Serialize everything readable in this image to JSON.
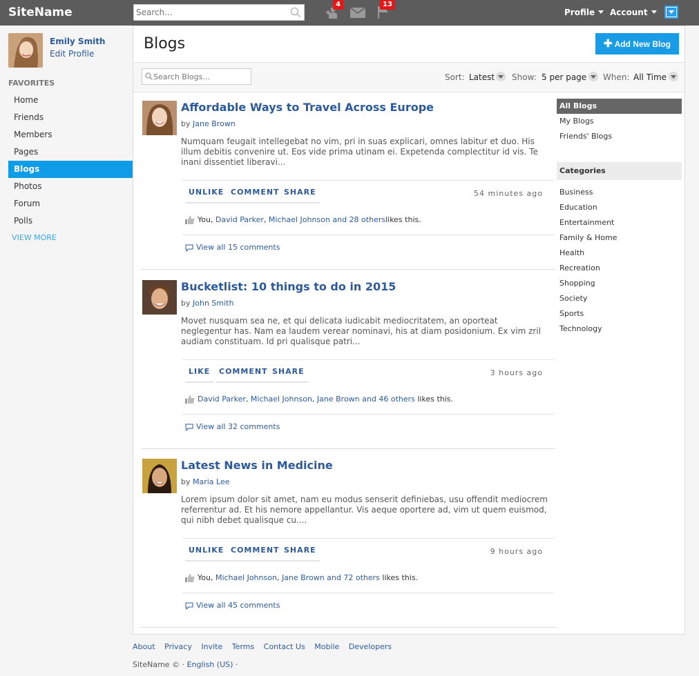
{
  "topbar": {
    "site_name": "SiteName",
    "search_placeholder": "Search...",
    "friend_requests_count": "4",
    "notifications_count": "13",
    "profile_menu": "Profile",
    "account_menu": "Account"
  },
  "sidebar": {
    "user_name": "Emily Smith",
    "edit_profile": "Edit Profile",
    "favorites_heading": "FAVORITES",
    "items": [
      {
        "label": "Home"
      },
      {
        "label": "Friends"
      },
      {
        "label": "Members"
      },
      {
        "label": "Pages"
      },
      {
        "label": "Blogs"
      },
      {
        "label": "Photos"
      },
      {
        "label": "Forum"
      },
      {
        "label": "Polls"
      }
    ],
    "active_item": "Blogs",
    "view_more": "VIEW MORE"
  },
  "main": {
    "title": "Blogs",
    "add_button": "Add New Blog",
    "search_placeholder": "Search Blogs...",
    "sort_label": "Sort:",
    "sort_value": "Latest",
    "show_label": "Show:",
    "show_value": "5 per page",
    "when_label": "When:",
    "when_value": "All Time"
  },
  "posts": [
    {
      "title": "Affordable Ways to Travel Across Europe",
      "by": "by",
      "author": "Jane Brown",
      "excerpt": "Numquam feugait intellegebat no vim, pri in suas explicari, omnes labitur et duo. His illum debitis convenire ut. Eos vide prima utinam ei. Expetenda complectitur id vis. Te inani dissentiet liberavi...",
      "like_action": "UNLIKE",
      "comment_action": "COMMENT",
      "share_action": "SHARE",
      "time": "54 minutes ago",
      "likes_prefix": "You, ",
      "likes_names": "David Parker",
      "likes_sep": ", ",
      "likes_more": "Michael Johnson and 28 others",
      "likes_suffix": "likes this.",
      "view_comments": "View all 15 comments"
    },
    {
      "title": "Bucketlist: 10 things to do in 2015",
      "by": "by",
      "author": "John Smith",
      "excerpt": "Movet nusquam sea ne, et qui delicata iudicabit mediocritatem, an oporteat neglegentur has. Nam ea laudem verear nominavi, his at diam posidonium. Ex vim zril audiam constituam. Id pri qualisque patri...",
      "like_action": "LIKE",
      "comment_action": "COMMENT",
      "share_action": "SHARE",
      "time": "3 hours ago",
      "likes_prefix": "",
      "likes_names": "David Parker, Michael Johnson",
      "likes_sep": ", ",
      "likes_more": "Jane Brown and 46 others",
      "likes_suffix": " likes this.",
      "view_comments": "View all 32 comments"
    },
    {
      "title": "Latest News in Medicine",
      "by": "by",
      "author": "Maria Lee",
      "excerpt": "Lorem ipsum dolor sit amet, nam eu modus senserit definiebas, usu offendit mediocrem referrentur ad. Et his nemore appellantur. Vis aeque oportere ad, vim ut quem euismod, qui nibh debet qualisque cu....",
      "like_action": "UNLIKE",
      "comment_action": "COMMENT",
      "share_action": "SHARE",
      "time": "9 hours ago",
      "likes_prefix": "You, ",
      "likes_names": "Michael Johnson",
      "likes_sep": ", ",
      "likes_more": "Jane Brown and 72 others",
      "likes_suffix": " likes this.",
      "view_comments": "View all 45 comments"
    }
  ],
  "right_nav": {
    "items": [
      {
        "label": "All Blogs"
      },
      {
        "label": "My Blogs"
      },
      {
        "label": "Friends' Blogs"
      }
    ],
    "categories_heading": "Categories",
    "categories": [
      {
        "label": "Business"
      },
      {
        "label": "Education"
      },
      {
        "label": "Entertainment"
      },
      {
        "label": "Family & Home"
      },
      {
        "label": "Health"
      },
      {
        "label": "Recreation"
      },
      {
        "label": "Shopping"
      },
      {
        "label": "Society"
      },
      {
        "label": "Sports"
      },
      {
        "label": "Technology"
      }
    ]
  },
  "footer": {
    "links": [
      {
        "label": "About"
      },
      {
        "label": "Privacy"
      },
      {
        "label": "Invite"
      },
      {
        "label": "Terms"
      },
      {
        "label": "Contact Us"
      },
      {
        "label": "Mobile"
      },
      {
        "label": "Developers"
      }
    ],
    "copyright": "SiteName © · ",
    "language": "English (US)",
    "trail": " ·"
  },
  "colors": {
    "topbar": "#5c5c5c",
    "accent_blue": "#0e9be8",
    "link_blue": "#2d5a9b",
    "badge_red": "#e01818"
  },
  "icons": {
    "search": "magnifier-icon",
    "friend_requests": "user-add-icon",
    "messages": "envelope-icon",
    "notifications": "flag-icon",
    "likes": "thumbs-up-icon",
    "comments": "speech-bubble-icon",
    "add": "plus-icon"
  }
}
